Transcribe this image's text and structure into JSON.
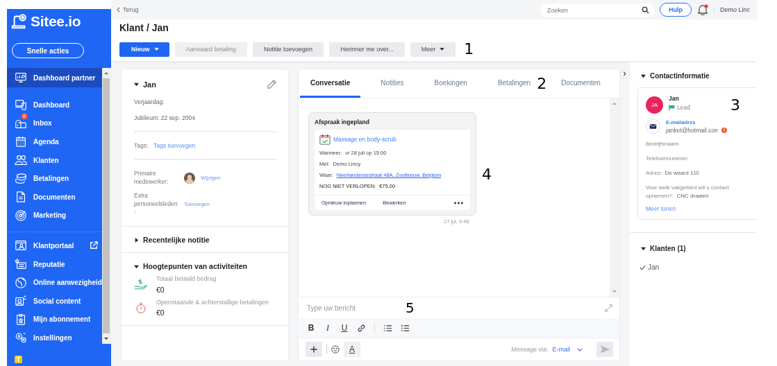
{
  "topbar": {
    "back": "Terug",
    "search_placeholder": "Zoeken",
    "help": "Hulp",
    "user": "Demo Linc"
  },
  "sidebar": {
    "logo": "Sitee.io",
    "quick_action": "Snelle acties",
    "sections": [
      {
        "items": [
          {
            "label": "Dashboard partner",
            "selected": true,
            "external": false
          }
        ]
      },
      {
        "items": [
          {
            "label": "Dashboard",
            "selected": false,
            "external": false
          },
          {
            "label": "Inbox",
            "selected": false,
            "external": false,
            "badge": "6"
          },
          {
            "label": "Agenda",
            "selected": false,
            "external": false
          },
          {
            "label": "Klanten",
            "selected": false,
            "external": false
          },
          {
            "label": "Betalingen",
            "selected": false,
            "external": false
          },
          {
            "label": "Documenten",
            "selected": false,
            "external": false
          },
          {
            "label": "Marketing",
            "selected": false,
            "external": false
          }
        ]
      },
      {
        "items": [
          {
            "label": "Klantportaal",
            "selected": false,
            "external": true
          },
          {
            "label": "Reputatie",
            "selected": false,
            "external": false
          },
          {
            "label": "Online aanwezigheid",
            "selected": false,
            "external": false
          },
          {
            "label": "Social content",
            "selected": false,
            "external": false
          },
          {
            "label": "Mijn abonnement",
            "selected": false,
            "external": false
          },
          {
            "label": "Instellingen",
            "selected": false,
            "external": false
          }
        ]
      }
    ]
  },
  "header": {
    "title": "Klant / Jan",
    "callout": "1",
    "buttons": [
      {
        "label": "Nieuw",
        "kind": "primary",
        "disabled": false,
        "dropdown": true
      },
      {
        "label": "Aanvaard betaling",
        "kind": "default",
        "disabled": true,
        "dropdown": false
      },
      {
        "label": "Notitie toevoegen",
        "kind": "default",
        "disabled": false,
        "dropdown": false
      },
      {
        "label": "Herinner me over...",
        "kind": "default",
        "disabled": false,
        "dropdown": false
      },
      {
        "label": "Meer",
        "kind": "default",
        "disabled": false,
        "dropdown": true
      }
    ]
  },
  "profile": {
    "name": "Jan",
    "expanded": true,
    "fields": [
      "Verjaardag:",
      "Jubileum: 22 sep. 2004"
    ],
    "tags_label": "Tags:",
    "tags_link": "Tags toevoegen",
    "staff": [
      {
        "label": "Primaire medewerker:",
        "link": "Wijzigen",
        "avatar": true
      },
      {
        "label": "Extra personeelsleden:",
        "link": "Toevoegen",
        "avatar": false
      }
    ],
    "sections": [
      {
        "title": "Recentelijke notitie",
        "expanded": false
      },
      {
        "title": "Hoogtepunten van activiteiten",
        "expanded": true,
        "stats": [
          {
            "label": "Totaal betaald bedrag",
            "value": "€0"
          },
          {
            "label": "Openstaande & achterstallige betalingen",
            "value": "€0"
          }
        ]
      }
    ]
  },
  "conversation": {
    "tabs": [
      {
        "label": "Conversatie",
        "selected": true
      },
      {
        "label": "Notities",
        "selected": false
      },
      {
        "label": "Boekingen",
        "selected": false
      },
      {
        "label": "Betalingen",
        "selected": false,
        "callout": "2"
      },
      {
        "label": "Documenten",
        "selected": false
      }
    ],
    "message": {
      "title": "Afspraak ingepland",
      "service": "Massage en body-scrub",
      "rows": [
        {
          "label": "Wanneer:",
          "value": "vr 28 juli op 15:00",
          "kind": "text"
        },
        {
          "label": "Met:",
          "value": "Demo Lincy",
          "kind": "text"
        },
        {
          "label": "Waar:",
          "value": "Neerlandensestraat 48A, Zoutleeuw, Belgium",
          "kind": "link"
        }
      ],
      "status": "NOG NIET VERLOPEN:",
      "amount": "€75.00",
      "actions": [
        "Opnieuw inplannen",
        "Bewerken"
      ],
      "time": "27 jul, 9:46",
      "callout": "4"
    },
    "composer": {
      "placeholder": "Type uw bericht",
      "callout": "5",
      "format": [
        "B",
        "I",
        "U"
      ],
      "text_color": "A",
      "via_label": "Message via:",
      "via_value": "E-mail"
    }
  },
  "contact": {
    "title": "Contactinformatie",
    "expanded": true,
    "initials": "JA",
    "name": "Jan",
    "status": "Lead",
    "callout": "3",
    "email_label": "E-mailadres",
    "email": "janket@hotmail.con",
    "email_warning": true,
    "fields": [
      {
        "label": "Bedrijfsnaam:"
      },
      {
        "label": "Telefoonnummer:"
      },
      {
        "label": "Adres:",
        "value": "De waard 110"
      },
      {
        "label": "Voor welk vakgebied wil u contact opnemen?:",
        "value": "CNC draaien"
      }
    ],
    "more": "Meer tonen"
  },
  "clients": {
    "title": "Klanten (1)",
    "expanded": true,
    "items": [
      "Jan"
    ]
  }
}
